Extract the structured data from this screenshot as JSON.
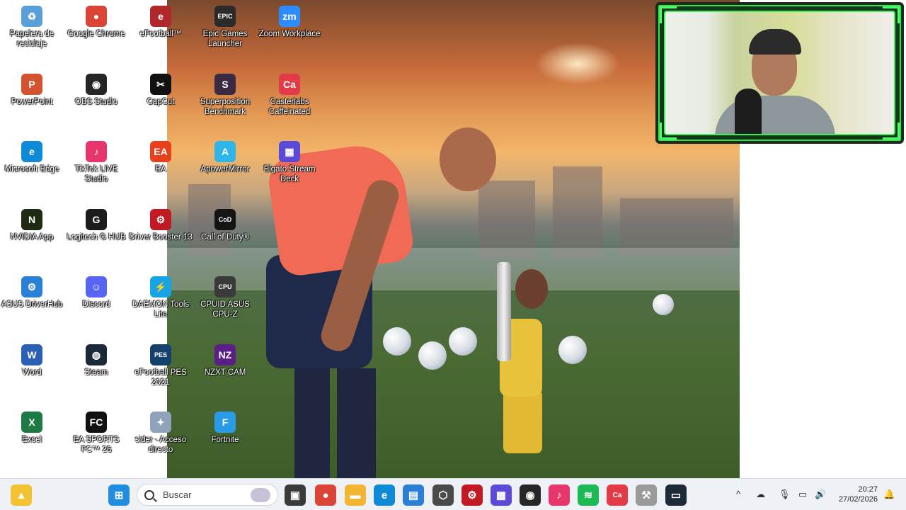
{
  "desktop": {
    "icons": [
      {
        "label": "Papelera de reciclaje",
        "icon": "recycle-bin-icon",
        "color": "#5aa0d8",
        "glyph": "♻",
        "col": 0,
        "row": 0
      },
      {
        "label": "Google Chrome",
        "icon": "chrome-icon",
        "color": "#db4437",
        "glyph": "●",
        "col": 1,
        "row": 0
      },
      {
        "label": "eFootball™",
        "icon": "efootball-icon",
        "color": "#b0282c",
        "glyph": "e",
        "col": 2,
        "row": 0
      },
      {
        "label": "Epic Games Launcher",
        "icon": "epic-games-icon",
        "color": "#2a2a2a",
        "glyph": "EPIC",
        "col": 3,
        "row": 0
      },
      {
        "label": "Zoom Workplace",
        "icon": "zoom-icon",
        "color": "#2d8cff",
        "glyph": "zm",
        "col": 4,
        "row": 0
      },
      {
        "label": "PowerPoint",
        "icon": "powerpoint-icon",
        "color": "#d35230",
        "glyph": "P",
        "col": 0,
        "row": 1
      },
      {
        "label": "OBS Studio",
        "icon": "obs-icon",
        "color": "#262626",
        "glyph": "◉",
        "col": 1,
        "row": 1
      },
      {
        "label": "CapCut",
        "icon": "capcut-icon",
        "color": "#111111",
        "glyph": "✂",
        "col": 2,
        "row": 1
      },
      {
        "label": "Superposition Benchmark",
        "icon": "superposition-icon",
        "color": "#3a2a44",
        "glyph": "S",
        "col": 3,
        "row": 1
      },
      {
        "label": "Casterlabs Caffeinated",
        "icon": "casterlabs-icon",
        "color": "#e23a46",
        "glyph": "Ca",
        "col": 4,
        "row": 1
      },
      {
        "label": "Microsoft Edge",
        "icon": "edge-icon",
        "color": "#0f8ad6",
        "glyph": "e",
        "col": 0,
        "row": 2
      },
      {
        "label": "TikTok LIVE Studio",
        "icon": "tiktok-live-icon",
        "color": "#e8356b",
        "glyph": "♪",
        "col": 1,
        "row": 2
      },
      {
        "label": "EA",
        "icon": "ea-icon",
        "color": "#e8401c",
        "glyph": "EA",
        "col": 2,
        "row": 2
      },
      {
        "label": "ApowerMirror",
        "icon": "apowermirror-icon",
        "color": "#2fb6e8",
        "glyph": "A",
        "col": 3,
        "row": 2
      },
      {
        "label": "Elgato Stream Deck",
        "icon": "stream-deck-icon",
        "color": "#5b4ad8",
        "glyph": "▦",
        "col": 4,
        "row": 2
      },
      {
        "label": "NVIDIA App",
        "icon": "nvidia-icon",
        "color": "#1e2a12",
        "glyph": "N",
        "col": 0,
        "row": 3
      },
      {
        "label": "Logitech G HUB",
        "icon": "logitech-ghub-icon",
        "color": "#1c1c1c",
        "glyph": "G",
        "col": 1,
        "row": 3
      },
      {
        "label": "Driver Booster 13",
        "icon": "driver-booster-icon",
        "color": "#c21a24",
        "glyph": "⚙",
        "col": 2,
        "row": 3
      },
      {
        "label": "Call of Duty®",
        "icon": "call-of-duty-icon",
        "color": "#141414",
        "glyph": "CoD",
        "col": 3,
        "row": 3
      },
      {
        "label": "ASUS DriverHub",
        "icon": "asus-driverhub-icon",
        "color": "#2a7fd6",
        "glyph": "⚙",
        "col": 0,
        "row": 4
      },
      {
        "label": "Discord",
        "icon": "discord-icon",
        "color": "#5865f2",
        "glyph": "☺",
        "col": 1,
        "row": 4
      },
      {
        "label": "DAEMON Tools Lite",
        "icon": "daemon-tools-icon",
        "color": "#17a3e4",
        "glyph": "⚡",
        "col": 2,
        "row": 4
      },
      {
        "label": "CPUID ASUS CPU-Z",
        "icon": "cpuz-icon",
        "color": "#3a3a3a",
        "glyph": "CPU",
        "col": 3,
        "row": 4
      },
      {
        "label": "Word",
        "icon": "word-icon",
        "color": "#2b5fb4",
        "glyph": "W",
        "col": 0,
        "row": 5
      },
      {
        "label": "Steam",
        "icon": "steam-icon",
        "color": "#1b2838",
        "glyph": "◍",
        "col": 1,
        "row": 5
      },
      {
        "label": "eFootball PES 2021",
        "icon": "pes-2021-icon",
        "color": "#14406b",
        "glyph": "PES",
        "col": 2,
        "row": 5
      },
      {
        "label": "NZXT CAM",
        "icon": "nzxt-cam-icon",
        "color": "#5a1f86",
        "glyph": "NZ",
        "col": 3,
        "row": 5
      },
      {
        "label": "Excel",
        "icon": "excel-icon",
        "color": "#1e7a45",
        "glyph": "X",
        "col": 0,
        "row": 6
      },
      {
        "label": "EA SPORTS FC™ 26",
        "icon": "ea-fc-26-icon",
        "color": "#111111",
        "glyph": "FC",
        "col": 1,
        "row": 6
      },
      {
        "label": "sider - Acceso directo",
        "icon": "sider-icon",
        "color": "#8fa3b8",
        "glyph": "✦",
        "col": 2,
        "row": 6
      },
      {
        "label": "Fortnite",
        "icon": "fortnite-icon",
        "color": "#2a9be8",
        "glyph": "F",
        "col": 3,
        "row": 6
      }
    ]
  },
  "taskbar": {
    "search_placeholder": "Buscar",
    "pinned": [
      {
        "icon": "sider-taskbar-icon",
        "color": "#f2c230",
        "glyph": "▲"
      },
      {
        "icon": "windows-start-icon",
        "color": "#1f8de0",
        "glyph": "⊞"
      },
      {
        "icon": "task-view-icon",
        "color": "#3a3a3a",
        "glyph": "▣"
      },
      {
        "icon": "chrome-taskbar-icon",
        "color": "#db4437",
        "glyph": "●"
      },
      {
        "icon": "file-explorer-icon",
        "color": "#f2b632",
        "glyph": "▬"
      },
      {
        "icon": "edge-taskbar-icon",
        "color": "#0f8ad6",
        "glyph": "e"
      },
      {
        "icon": "microsoft-store-icon",
        "color": "#2b7fd6",
        "glyph": "▤"
      },
      {
        "icon": "cube-app-icon",
        "color": "#4a4a4a",
        "glyph": "⬡"
      },
      {
        "icon": "driver-booster-taskbar-icon",
        "color": "#c21a24",
        "glyph": "⚙"
      },
      {
        "icon": "stream-deck-taskbar-icon",
        "color": "#5b4ad8",
        "glyph": "▦"
      },
      {
        "icon": "obs-taskbar-icon",
        "color": "#262626",
        "glyph": "◉"
      },
      {
        "icon": "tiktok-taskbar-icon",
        "color": "#e8356b",
        "glyph": "♪"
      },
      {
        "icon": "spotify-icon",
        "color": "#1db954",
        "glyph": "≋"
      },
      {
        "icon": "casterlabs-taskbar-icon",
        "color": "#e23a46",
        "glyph": "Ca"
      },
      {
        "icon": "tools-icon",
        "color": "#9a9a9a",
        "glyph": "⚒"
      },
      {
        "icon": "monitor-app-icon",
        "color": "#1c2a3a",
        "glyph": "▭"
      }
    ],
    "tray": {
      "chevron": "^",
      "clock_time": "20:27",
      "clock_date": "27/02/2026"
    }
  }
}
